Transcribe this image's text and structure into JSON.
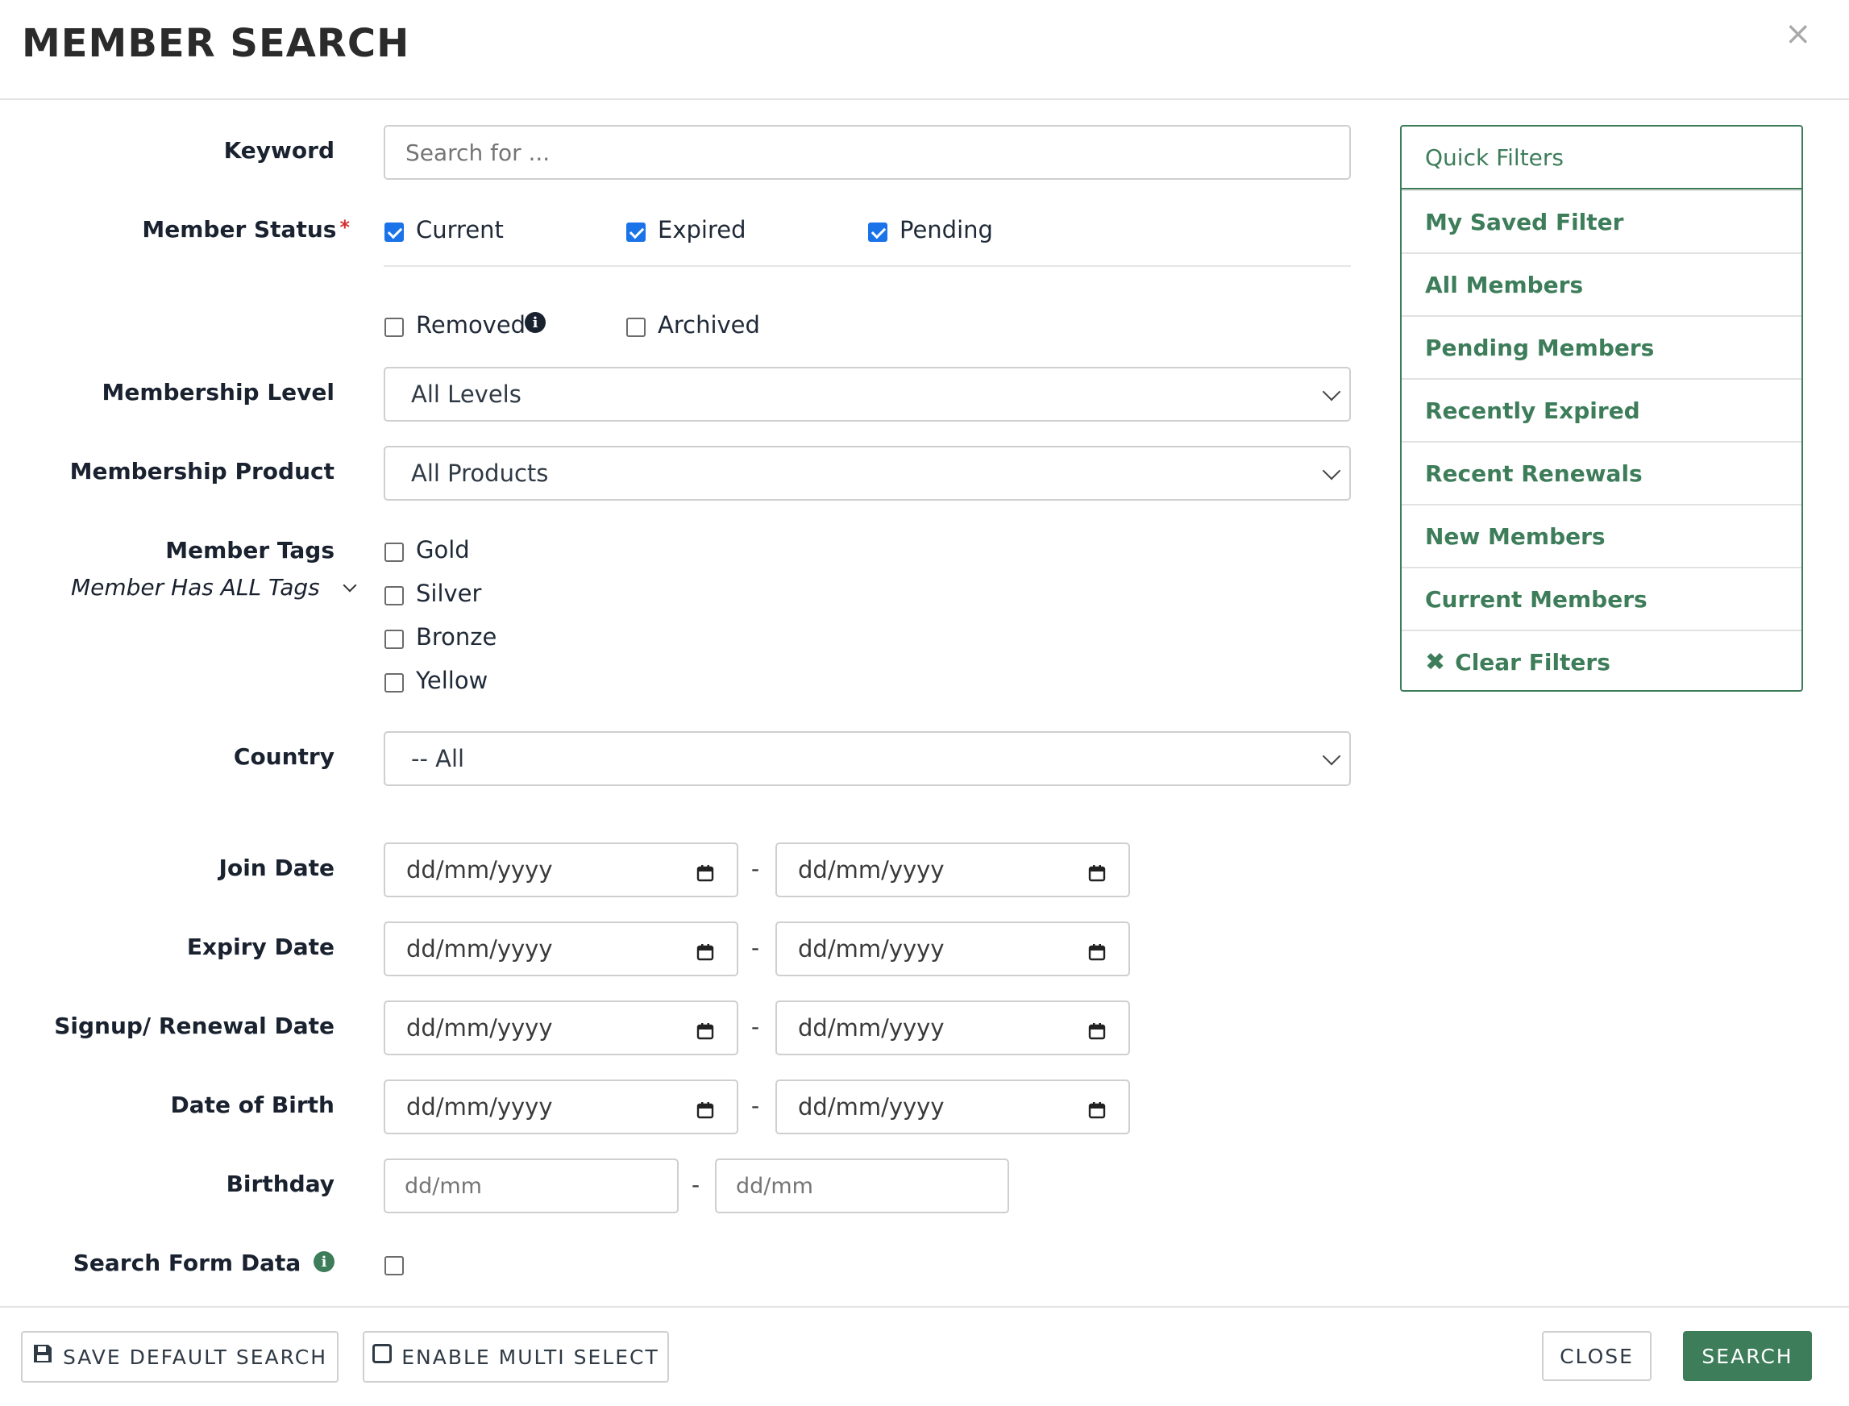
{
  "dialog": {
    "title": "MEMBER SEARCH",
    "close_symbol": "×"
  },
  "form": {
    "keyword": {
      "label": "Keyword",
      "placeholder": "Search for ..."
    },
    "member_status": {
      "label": "Member Status",
      "required_mark": "*",
      "options": [
        {
          "label": "Current",
          "checked": true
        },
        {
          "label": "Expired",
          "checked": true
        },
        {
          "label": "Pending",
          "checked": true
        },
        {
          "label": "Removed",
          "checked": false
        },
        {
          "label": "Archived",
          "checked": false
        }
      ]
    },
    "membership_level": {
      "label": "Membership Level",
      "value": "All Levels"
    },
    "membership_product": {
      "label": "Membership Product",
      "value": "All Products"
    },
    "member_tags": {
      "label": "Member Tags",
      "match_mode": "Member Has ALL Tags",
      "options": [
        {
          "label": "Gold",
          "checked": false
        },
        {
          "label": "Silver",
          "checked": false
        },
        {
          "label": "Bronze",
          "checked": false
        },
        {
          "label": "Yellow",
          "checked": false
        }
      ]
    },
    "country": {
      "label": "Country",
      "value": "-- All"
    },
    "date_placeholder": "dd/mm/yyyy",
    "range_separator": "-",
    "dates": [
      {
        "label": "Join Date"
      },
      {
        "label": "Expiry Date"
      },
      {
        "label": "Signup/ Renewal Date"
      },
      {
        "label": "Date of Birth"
      }
    ],
    "birthday": {
      "label": "Birthday",
      "placeholder": "dd/mm"
    },
    "search_form_data": {
      "label": "Search Form Data",
      "checked": false
    }
  },
  "quick_filters": {
    "heading": "Quick Filters",
    "items": [
      "My Saved Filter",
      "All Members",
      "Pending Members",
      "Recently Expired",
      "Recent Renewals",
      "New Members",
      "Current Members"
    ],
    "clear": "Clear Filters"
  },
  "footer": {
    "save_default": "SAVE DEFAULT SEARCH",
    "multi_select": "ENABLE MULTI SELECT",
    "close": "CLOSE",
    "search": "SEARCH"
  },
  "colors": {
    "accent_green": "#3d7d5a",
    "checkbox_blue": "#1a73e8",
    "required_red": "#d32f2f",
    "info_icon_dark": "#1a2230"
  },
  "icons": {
    "removed_info": "info-circle-icon",
    "form_data_info": "info-circle-icon",
    "date_picker": "calendar-icon",
    "select_caret": "chevron-down-icon",
    "clear_filters": "x-icon",
    "save": "floppy-disk-icon",
    "multi_select": "square-outline-icon"
  }
}
